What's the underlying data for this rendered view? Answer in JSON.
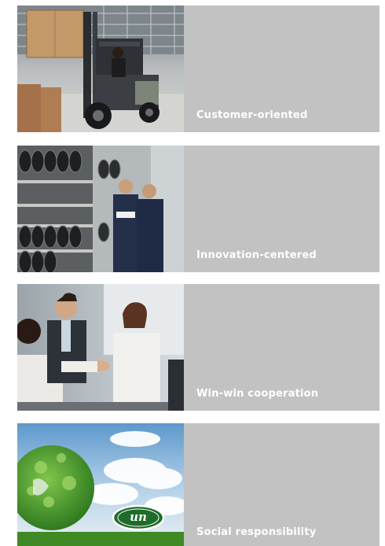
{
  "cards": [
    {
      "label": "Customer-oriented"
    },
    {
      "label": "Innovation-centered"
    },
    {
      "label": "Win-win cooperation"
    },
    {
      "label": "Social responsibility"
    }
  ],
  "logo": {
    "text": "un"
  }
}
